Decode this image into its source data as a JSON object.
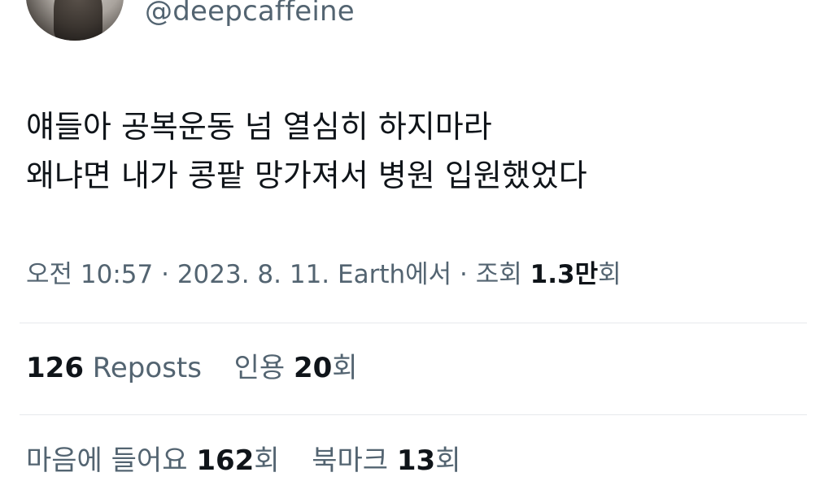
{
  "author": {
    "handle": "@deepcaffeine"
  },
  "tweet": {
    "lines": [
      "얘들아 공복운동 넘 열심히 하지마라",
      "왜냐면 내가 콩팥 망가져서 병원 입원했었다"
    ]
  },
  "meta": {
    "time": "오전 10:57",
    "sep": "·",
    "date": "2023. 8. 11.",
    "source": "Earth에서",
    "views_label": "조회",
    "views_value": "1.3만",
    "views_suffix": "회"
  },
  "engagement": {
    "reposts_count": "126",
    "reposts_label": "Reposts",
    "quotes_label": "인용",
    "quotes_count": "20",
    "quotes_suffix": "회",
    "likes_label": "마음에 들어요",
    "likes_count": "162",
    "likes_suffix": "회",
    "bookmarks_label": "북마크",
    "bookmarks_count": "13",
    "bookmarks_suffix": "회"
  }
}
